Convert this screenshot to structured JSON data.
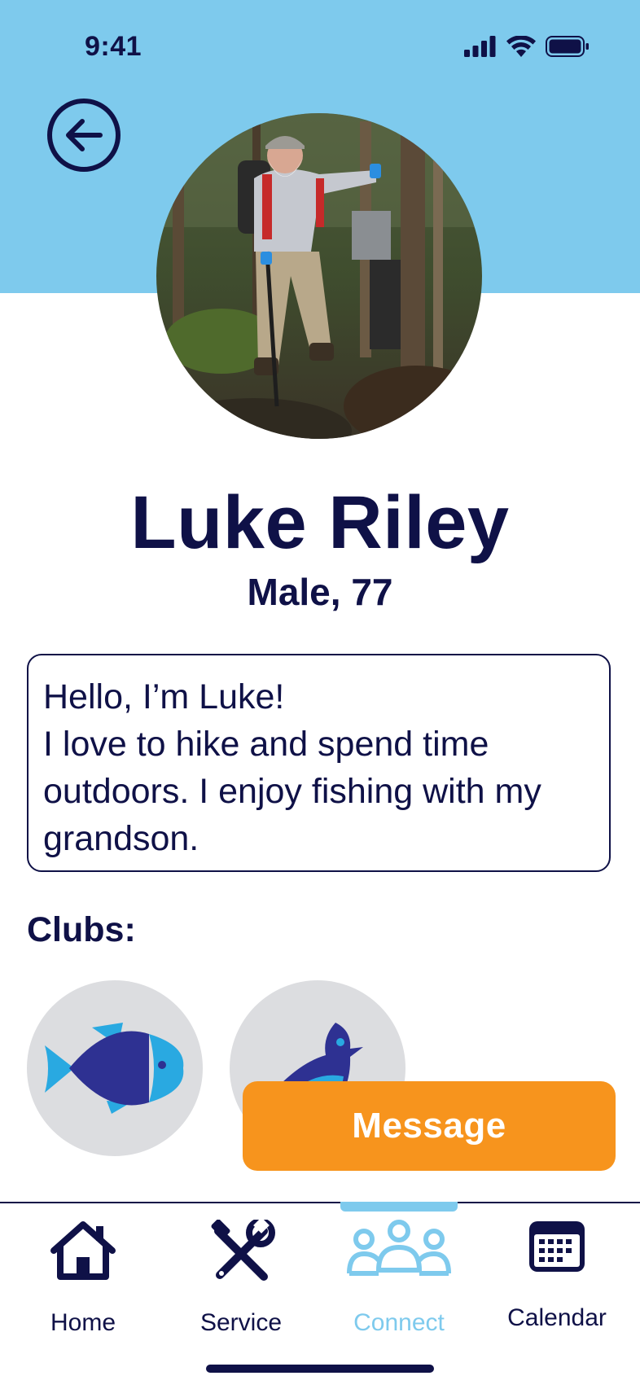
{
  "status_bar": {
    "time": "9:41"
  },
  "header": {
    "back_icon": "arrow-left-circle-icon"
  },
  "profile": {
    "name": "Luke Riley",
    "subtitle": "Male, 77",
    "photo_alt": "Photo of Luke Riley hiking in a forest",
    "bio_lines": [
      "Hello, I’m Luke!",
      "I love to hike and spend time",
      "outdoors. I enjoy fishing with my",
      "grandson."
    ]
  },
  "clubs": {
    "label": "Clubs:",
    "items": [
      {
        "icon": "fish-icon"
      },
      {
        "icon": "bird-icon"
      }
    ]
  },
  "message_button": {
    "label": "Message"
  },
  "tabbar": {
    "items": [
      {
        "label": "Home",
        "icon": "home-icon"
      },
      {
        "label": "Service",
        "icon": "tools-icon"
      },
      {
        "label": "Connect",
        "icon": "people-icon",
        "active": true
      },
      {
        "label": "Calendar",
        "icon": "calendar-icon"
      }
    ]
  },
  "colors": {
    "header": "#7ecaed",
    "primary_text": "#0f1147",
    "accent_orange": "#f7941d",
    "active_tab": "#7ecaed",
    "club_bg": "#dcdde0"
  }
}
